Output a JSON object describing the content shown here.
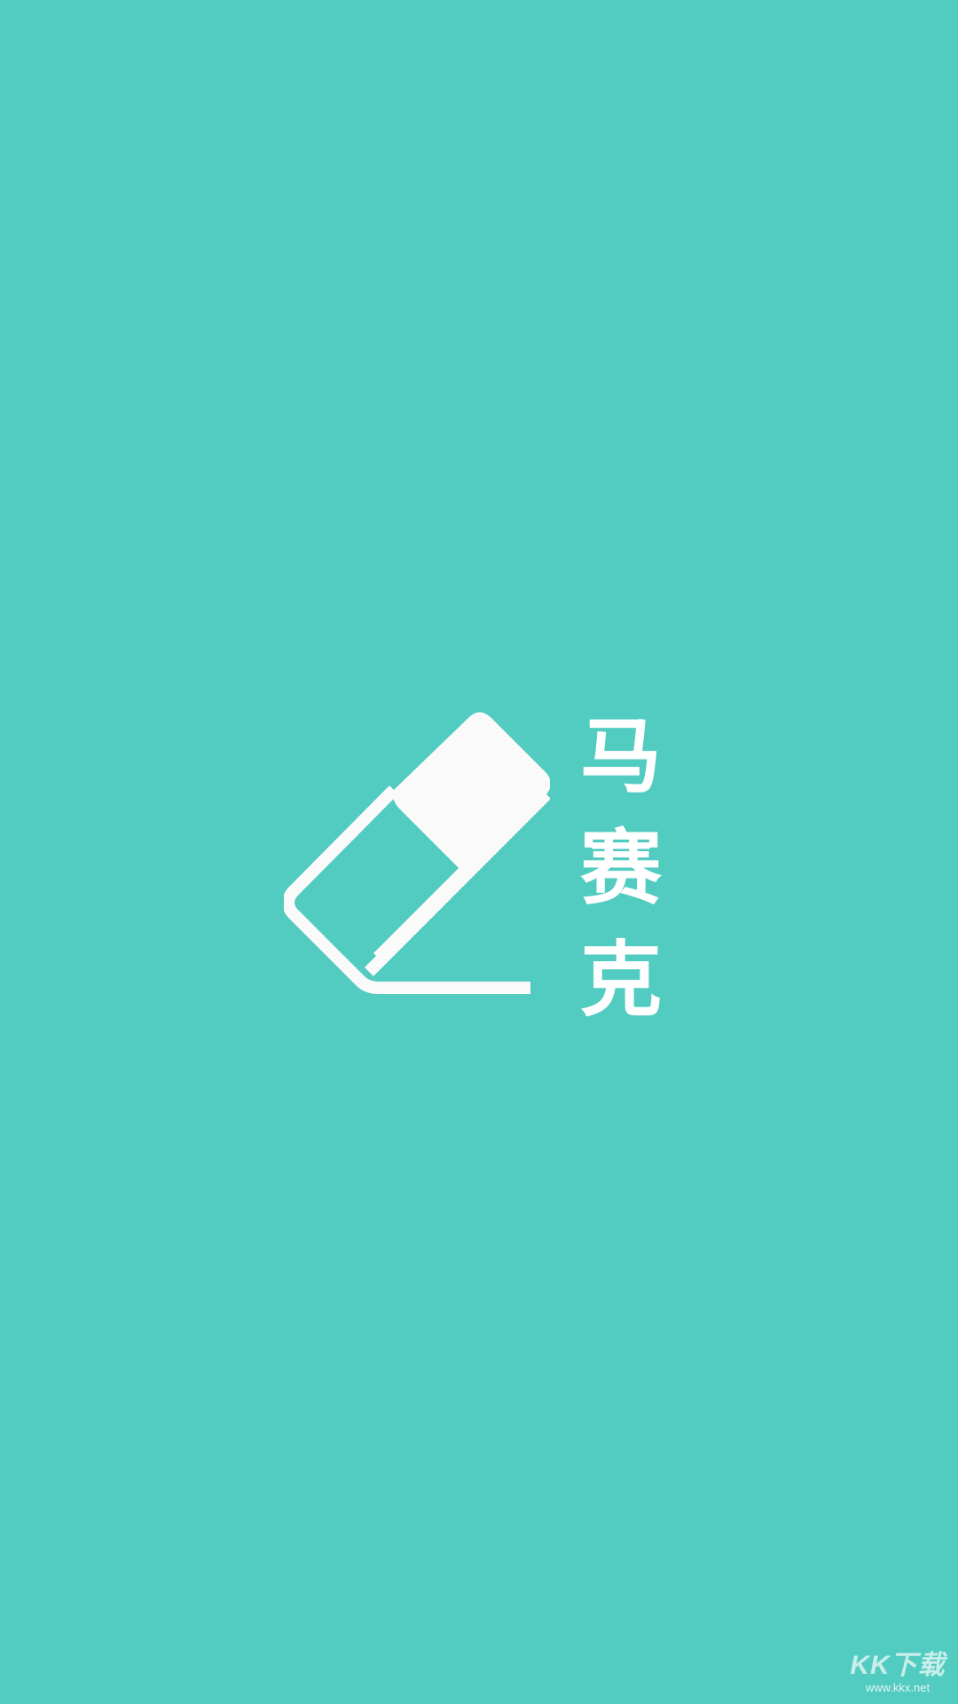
{
  "app": {
    "logo_icon": "eraser-icon",
    "name_chars": [
      "马",
      "赛",
      "克"
    ]
  },
  "watermark": {
    "logo_text": "KK下载",
    "url": "www.kkx.net"
  },
  "colors": {
    "background": "#52cbc1",
    "logo": "#fafafa",
    "text": "#ffffff"
  }
}
